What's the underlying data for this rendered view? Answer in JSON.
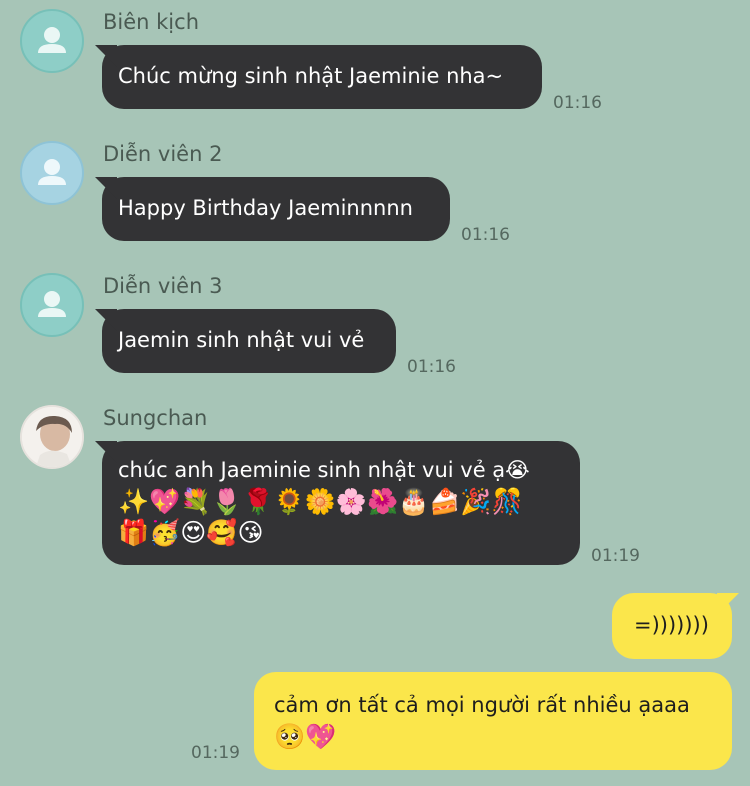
{
  "messages": [
    {
      "sender": "Biên kịch",
      "avatar": "default-person-icon",
      "text": "Chúc mừng sinh nhật Jaeminie nha~",
      "time": "01:16"
    },
    {
      "sender": "Diễn viên 2",
      "avatar": "default-person-icon",
      "text": "Happy Birthday Jaeminnnnn",
      "time": "01:16"
    },
    {
      "sender": "Diễn viên 3",
      "avatar": "default-person-icon",
      "text": "Jaemin sinh nhật vui vẻ",
      "time": "01:16"
    },
    {
      "sender": "Sungchan",
      "avatar": "profile-photo",
      "text_line1": "chúc anh Jaeminie sinh nhật vui vẻ ạ😭",
      "text_line2": "✨💖💐🌷🌹🌻🌼🌸🌺🎂🍰🎉🎊",
      "text_line3": "🎁🥳😍🥰😘",
      "time": "01:19"
    }
  ],
  "own_messages": [
    {
      "text": "=)))))))",
      "time": ""
    },
    {
      "text_line1": "cảm ơn tất cả mọi người rất nhiều ạaaa",
      "text_line2": "🥺💖",
      "time": "01:19"
    }
  ],
  "colors": {
    "background": "#a7c5b7",
    "incoming_bubble": "#333335",
    "outgoing_bubble": "#fbe64b"
  }
}
